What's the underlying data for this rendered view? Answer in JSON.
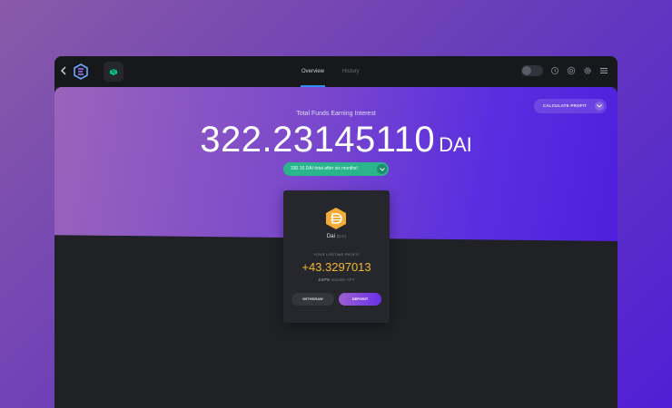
{
  "header": {
    "tabs": [
      {
        "label": "Overview",
        "active": true
      },
      {
        "label": "History",
        "active": false
      }
    ]
  },
  "hero": {
    "calculate_label": "CALCULATE PROFIT",
    "funds_label": "Total Funds Earning Interest",
    "balance": "322.23145110",
    "unit": "DAI",
    "projection": "330.16 DAI total after six months!"
  },
  "card": {
    "coin_name": "Dai",
    "coin_ticker": "(DAI)",
    "profit_label": "YOUR LIFETIME PROFIT",
    "profit_value": "+43.3297013",
    "apy_value": "2.67%",
    "apy_label": "Variable APY",
    "withdraw_label": "WITHDRAW",
    "deposit_label": "DEPOSIT"
  },
  "colors": {
    "accent_blue": "#2f8ef5",
    "projection_green": "#2bb58c",
    "profit_gold": "#f4b731",
    "dai_orange": "#f5ac37"
  },
  "icons": [
    "back-icon",
    "exodus-logo-icon",
    "compound-app-icon",
    "lock-toggle",
    "history-icon",
    "support-icon",
    "settings-icon",
    "menu-icon",
    "chevron-down-icon",
    "dai-coin-icon"
  ]
}
